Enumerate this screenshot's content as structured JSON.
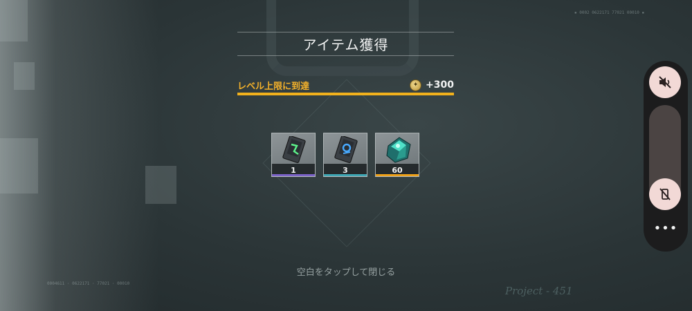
{
  "dialog": {
    "title": "アイテム獲得",
    "level_notice": "レベル上限に到達",
    "bonus_icon": "coin-icon",
    "bonus_value": "+300",
    "close_hint": "空白をタップして閉じる"
  },
  "items": [
    {
      "icon": "green-data-card-icon",
      "count": "1",
      "rarity_color": "#7c63c8"
    },
    {
      "icon": "blue-data-card-icon",
      "count": "3",
      "rarity_color": "#3fa7b5"
    },
    {
      "icon": "teal-crystal-icon",
      "count": "60",
      "rarity_color": "#f0a21a"
    }
  ],
  "background": {
    "watermark": "Project - 451",
    "hud_code_top_right": "▪ 0002 0622171 77021 00010 ▪",
    "hud_code_bottom_left": "0004611 · 0622171 · 77021 · 00010"
  },
  "overlay_panel": {
    "mute_icon": "speaker-muted-icon",
    "vibrate_icon": "vibration-off-icon",
    "more_icon": "more-dots-icon",
    "more_label": "•••"
  },
  "colors": {
    "accent": "#f2b11c",
    "panel": "#1c1c1d",
    "panel_button": "#f2d9d6"
  }
}
